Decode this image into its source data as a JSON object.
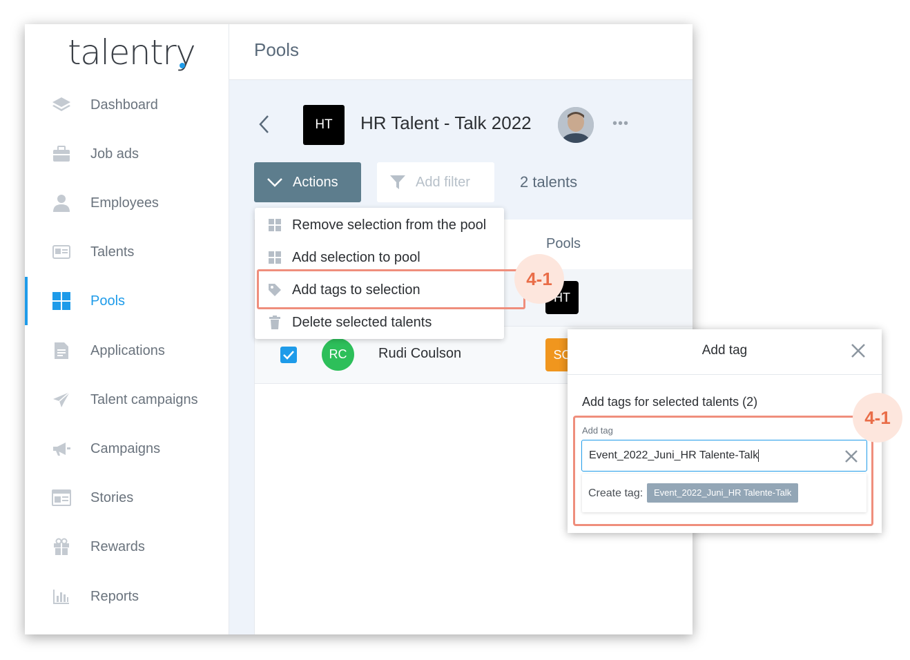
{
  "app": {
    "logo_text": "talentry"
  },
  "colors": {
    "accent": "#1e9be9",
    "actions_button": "#5d7d8d",
    "highlight": "#ef8e7c",
    "badge_bg": "#fde6dd",
    "badge_text": "#e96d48"
  },
  "sidebar": {
    "items": [
      {
        "label": "Dashboard",
        "icon": "layers-icon"
      },
      {
        "label": "Job ads",
        "icon": "briefcase-icon"
      },
      {
        "label": "Employees",
        "icon": "person-icon"
      },
      {
        "label": "Talents",
        "icon": "id-card-icon"
      },
      {
        "label": "Pools",
        "icon": "grid-icon",
        "active": true
      },
      {
        "label": "Applications",
        "icon": "document-icon"
      },
      {
        "label": "Talent campaigns",
        "icon": "paper-plane-icon"
      },
      {
        "label": "Campaigns",
        "icon": "megaphone-icon"
      },
      {
        "label": "Stories",
        "icon": "newspaper-icon"
      },
      {
        "label": "Rewards",
        "icon": "gift-icon"
      },
      {
        "label": "Reports",
        "icon": "bar-chart-icon"
      }
    ]
  },
  "header": {
    "page_title": "Pools"
  },
  "pool": {
    "logo_text": "HT",
    "name": "HR Talent - Talk 2022",
    "more": "•••"
  },
  "toolbar": {
    "actions_label": "Actions",
    "filter_label": "Add filter",
    "talent_count": "2 talents"
  },
  "actions_menu": {
    "items": [
      {
        "label": "Remove selection from the pool",
        "icon": "grid-icon"
      },
      {
        "label": "Add selection to pool",
        "icon": "grid-icon"
      },
      {
        "label": "Add tags to selection",
        "icon": "tag-icon"
      },
      {
        "label": "Delete selected talents",
        "icon": "trash-icon"
      }
    ]
  },
  "table": {
    "columns": {
      "pools": "Pools"
    },
    "rows": [
      {
        "pool_chip": "HT"
      },
      {
        "checked": true,
        "initials": "RC",
        "name": "Rudi Coulson",
        "pool_chip": "SC"
      }
    ]
  },
  "annotations": {
    "step_badge": "4-1"
  },
  "modal": {
    "title": "Add tag",
    "subtitle": "Add tags for selected talents (2)",
    "field_label": "Add tag",
    "input_value": "Event_2022_Juni_HR Talente-Talk",
    "create_label": "Create tag:",
    "create_chip": "Event_2022_Juni_HR Talente-Talk"
  }
}
